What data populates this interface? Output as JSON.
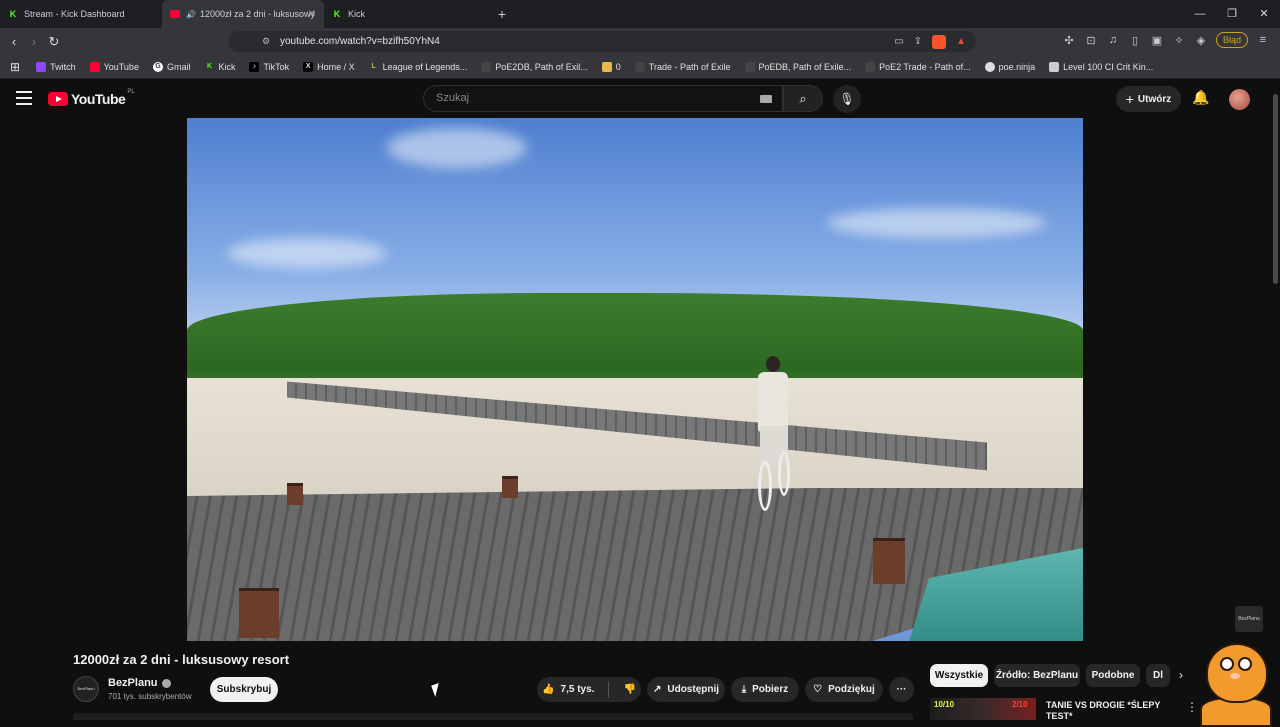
{
  "browser": {
    "tabs": [
      {
        "title": "Stream - Kick Dashboard",
        "favicon": "kick-icon",
        "active": false
      },
      {
        "title": "12000zł za 2 dni - luksusowy",
        "favicon": "youtube-icon",
        "active": true
      },
      {
        "title": "Kick",
        "favicon": "kick-icon",
        "active": false
      }
    ],
    "url": "youtube.com/watch?v=bzifh50YhN4",
    "profile_badge": "Błąd",
    "bookmarks": [
      {
        "label": "Twitch",
        "color": "#9146ff"
      },
      {
        "label": "YouTube",
        "color": "#ff0033"
      },
      {
        "label": "Gmail",
        "color": "#ffffff"
      },
      {
        "label": "Kick",
        "color": "#53fc18"
      },
      {
        "label": "TikTok",
        "color": "#000000"
      },
      {
        "label": "Home / X",
        "color": "#000000"
      },
      {
        "label": "League of Legends...",
        "color": "#c8aa6e"
      },
      {
        "label": "PoE2DB, Path of Exil...",
        "color": "#444444"
      },
      {
        "label": "0",
        "color": "#e8b84a"
      },
      {
        "label": "Trade - Path of Exile",
        "color": "#444444"
      },
      {
        "label": "PoEDB, Path of Exile...",
        "color": "#444444"
      },
      {
        "label": "PoE2 Trade - Path of...",
        "color": "#444444"
      },
      {
        "label": "poe.ninja",
        "color": "#dddddd"
      },
      {
        "label": "Level 100 CI Crit Kin...",
        "color": "#cccccc"
      }
    ]
  },
  "youtube": {
    "logo_text": "YouTube",
    "country_code": "PL",
    "search_placeholder": "Szukaj",
    "create_label": "Utwórz"
  },
  "player": {
    "watermark": "BezPlanu"
  },
  "video": {
    "title": "12000zł za 2 dni - luksusowy resort",
    "channel_name": "BezPlanu",
    "subscribers": "701 tys. subskrybentów",
    "subscribe_label": "Subskrybuj",
    "likes": "7,5 tys.",
    "share_label": "Udostępnij",
    "download_label": "Pobierz",
    "thanks_label": "Podziękuj",
    "more_label": "···"
  },
  "sidebar": {
    "chips": [
      "Wszystkie",
      "Źródło: BezPlanu",
      "Podobne",
      "Dl"
    ],
    "recommendation": {
      "badge_left": "10/10",
      "badge_right": "2/10",
      "title": "TANIE VS DROGIE *ŚLEPY TEST*"
    }
  }
}
